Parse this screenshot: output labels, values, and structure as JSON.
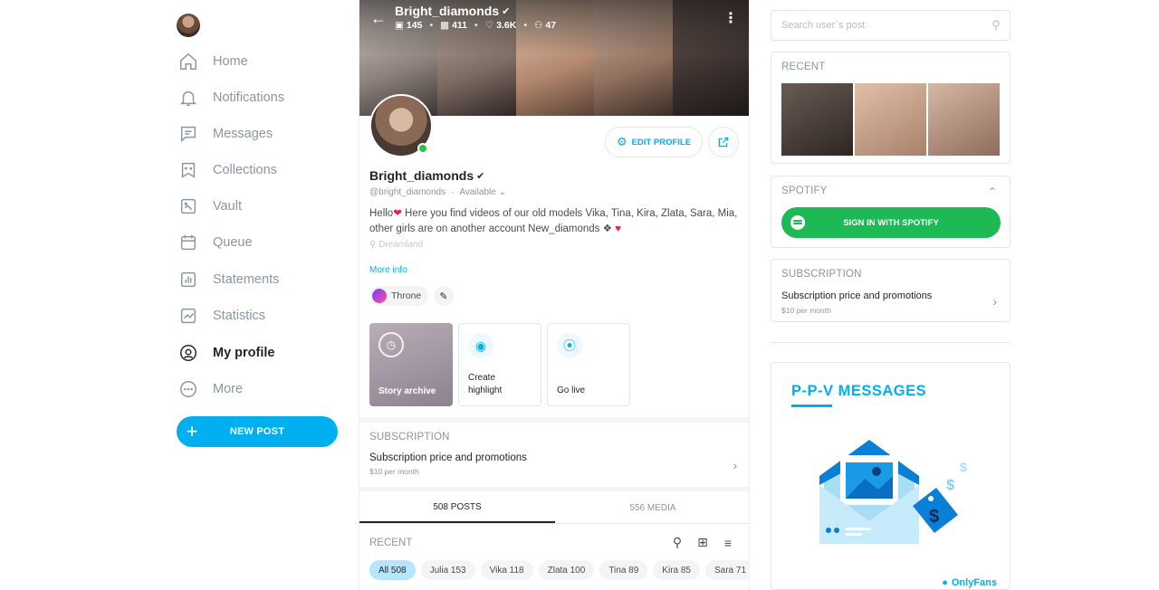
{
  "sidebar": {
    "items": [
      {
        "label": "Home",
        "icon": "home-icon"
      },
      {
        "label": "Notifications",
        "icon": "bell-icon"
      },
      {
        "label": "Messages",
        "icon": "message-icon"
      },
      {
        "label": "Collections",
        "icon": "bookmark-icon"
      },
      {
        "label": "Vault",
        "icon": "vault-icon"
      },
      {
        "label": "Queue",
        "icon": "calendar-icon"
      },
      {
        "label": "Statements",
        "icon": "statements-icon"
      },
      {
        "label": "Statistics",
        "icon": "chart-icon"
      },
      {
        "label": "My profile",
        "icon": "profile-icon",
        "active": true
      },
      {
        "label": "More",
        "icon": "more-icon"
      }
    ],
    "new_post_label": "NEW POST"
  },
  "cover": {
    "name": "Bright_diamonds",
    "stats": {
      "photos": "145",
      "videos": "411",
      "likes": "3.6K",
      "fans": "47"
    }
  },
  "profile": {
    "edit_label": "EDIT PROFILE",
    "name": "Bright_diamonds",
    "handle": "@bright_diamonds",
    "status": "Available",
    "bio_part1": "Hello",
    "bio_part2": " Here you find videos of our old models Vika, Tina, Kira, Zlata, Sara, Mia, other girls are on another account New_diamonds",
    "location": "Dreamland",
    "more_info": "More info",
    "throne_label": "Throne"
  },
  "tiles": {
    "archive": "Story archive",
    "highlight_line1": "Create",
    "highlight_line2": "highlight",
    "live": "Go live"
  },
  "subscription": {
    "heading": "SUBSCRIPTION",
    "title": "Subscription price and promotions",
    "price": "$10 per month"
  },
  "tabs": [
    {
      "label": "508 POSTS",
      "active": true
    },
    {
      "label": "556 MEDIA",
      "active": false
    }
  ],
  "recent": {
    "label": "RECENT",
    "chips": [
      {
        "label": "All 508",
        "active": true
      },
      {
        "label": "Julia 153"
      },
      {
        "label": "Vika 118"
      },
      {
        "label": "Zlata 100"
      },
      {
        "label": "Tina 89"
      },
      {
        "label": "Kira 85"
      },
      {
        "label": "Sara 71"
      }
    ]
  },
  "right": {
    "search_placeholder": "Search user`s post",
    "recent_title": "RECENT",
    "spotify_title": "SPOTIFY",
    "spotify_button": "SIGN IN WITH SPOTIFY",
    "subscription_title": "SUBSCRIPTION",
    "subscription_text": "Subscription price and promotions",
    "subscription_price": "$10 per month",
    "promo_title": "P-P-V  MESSAGES",
    "brand": "OnlyFans"
  },
  "colors": {
    "accent": "#00aff0",
    "spotify": "#1db954",
    "online": "#29c449",
    "muted_text": "#8a96a3"
  }
}
